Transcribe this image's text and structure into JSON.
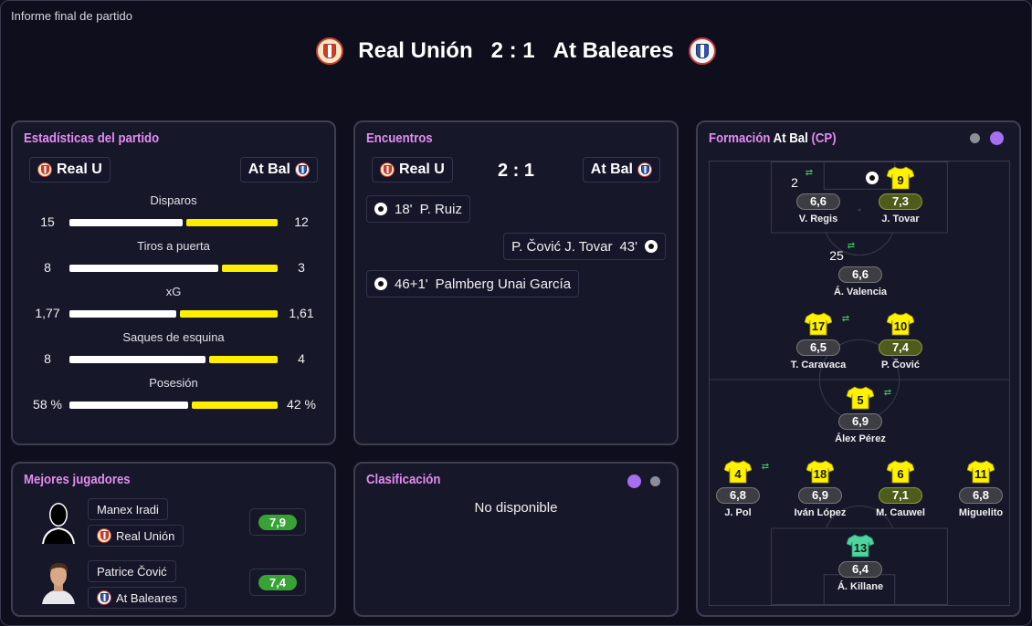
{
  "report_title": "Informe final de partido",
  "match": {
    "home": "Real Unión",
    "away": "At Baleares",
    "score": "2 : 1"
  },
  "stats": {
    "title": "Estadísticas del partido",
    "home_short": "Real U",
    "away_short": "At Bal",
    "rows": [
      {
        "label": "Disparos",
        "home": "15",
        "away": "12",
        "home_value": 15,
        "away_value": 12
      },
      {
        "label": "Tiros a puerta",
        "home": "8",
        "away": "3",
        "home_value": 8,
        "away_value": 3
      },
      {
        "label": "xG",
        "home": "1,77",
        "away": "1,61",
        "home_value": 1.77,
        "away_value": 1.61
      },
      {
        "label": "Saques de esquina",
        "home": "8",
        "away": "4",
        "home_value": 8,
        "away_value": 4
      },
      {
        "label": "Posesión",
        "home": "58 %",
        "away": "42 %",
        "home_value": 58,
        "away_value": 42
      }
    ]
  },
  "encounters": {
    "title": "Encuentros",
    "home_short": "Real U",
    "away_short": "At Bal",
    "score": "2 : 1",
    "events": [
      {
        "side": "home",
        "minute": "18'",
        "text": "P. Ruiz"
      },
      {
        "side": "away",
        "minute": "43'",
        "text": "P. Čović  J. Tovar"
      },
      {
        "side": "home",
        "minute": "46+1'",
        "text": "Palmberg  Unai García"
      }
    ]
  },
  "best_players": {
    "title": "Mejores jugadores",
    "players": [
      {
        "name": "Manex Iradi",
        "team": "Real Unión",
        "rating": "7,9"
      },
      {
        "name": "Patrice Čović",
        "team": "At Baleares",
        "rating": "7,4"
      }
    ]
  },
  "classification": {
    "title": "Clasificación",
    "message": "No disponible"
  },
  "formation": {
    "title_prefix": "Formación",
    "team": "At Bal",
    "suffix": "(CP)",
    "players": [
      {
        "num": "9",
        "rating": "7,3",
        "name": "J. Tovar",
        "hi": true,
        "swap": false
      },
      {
        "num": "",
        "rating": "6,6",
        "name": "V. Regis",
        "hi": false,
        "swap": true,
        "badge": "2"
      },
      {
        "num": "",
        "rating": "6,6",
        "name": "Á. Valencia",
        "hi": false,
        "swap": true,
        "badge": "25"
      },
      {
        "num": "17",
        "rating": "6,5",
        "name": "T. Caravaca",
        "hi": false,
        "swap": true
      },
      {
        "num": "10",
        "rating": "7,4",
        "name": "P. Čović",
        "hi": true,
        "swap": false
      },
      {
        "num": "5",
        "rating": "6,9",
        "name": "Álex Pérez",
        "hi": false,
        "swap": true
      },
      {
        "num": "4",
        "rating": "6,8",
        "name": "J. Pol",
        "hi": false,
        "swap": true
      },
      {
        "num": "18",
        "rating": "6,9",
        "name": "Iván López",
        "hi": false,
        "swap": false
      },
      {
        "num": "6",
        "rating": "7,1",
        "name": "M. Cauwel",
        "hi": true,
        "swap": false
      },
      {
        "num": "11",
        "rating": "6,8",
        "name": "Miguelito",
        "hi": false,
        "swap": false
      },
      {
        "num": "13",
        "rating": "6,4",
        "name": "Á. Killane",
        "hi": false,
        "swap": false,
        "gk": true
      }
    ]
  },
  "colors": {
    "accent": "#e48cf1",
    "home_bar": "#ffffff",
    "away_bar": "#ffee00",
    "rating_green": "#37a336",
    "dot_purple": "#a86ef0",
    "dot_grey": "#8a8f99"
  }
}
